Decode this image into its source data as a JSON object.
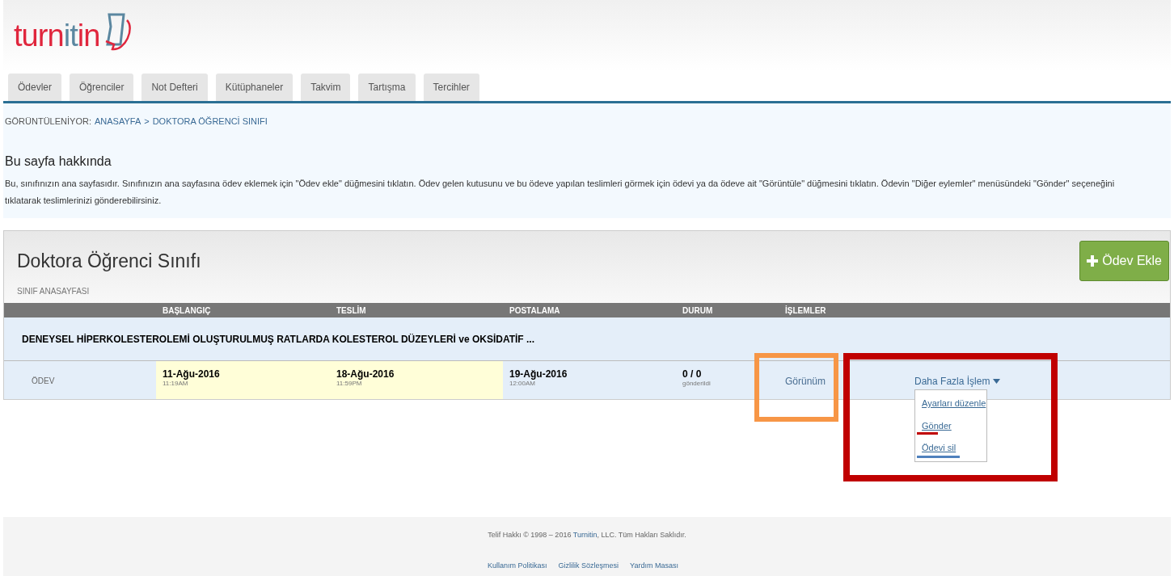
{
  "logo": {
    "parts": [
      {
        "text": "turn",
        "color": "#e0263d"
      },
      {
        "text": "it",
        "color": "#5b87a0"
      },
      {
        "text": "in",
        "color": "#e0263d"
      }
    ]
  },
  "tabs": [
    "Ödevler",
    "Öğrenciler",
    "Not Defteri",
    "Kütüphaneler",
    "Takvim",
    "Tartışma",
    "Tercihler"
  ],
  "breadcrumb": {
    "prefix": "GÖRÜNTÜLENİYOR:",
    "items": [
      "ANASAYFA",
      "DOKTORA ÖĞRENCİ SINIFI"
    ],
    "separator": ">"
  },
  "about": {
    "title": "Bu sayfa hakkında",
    "text": "Bu, sınıfınızın ana sayfasıdır. Sınıfınızın ana sayfasına ödev eklemek için \"Ödev ekle\" düğmesini tıklatın. Ödev gelen kutusunu ve bu ödeve yapılan teslimleri görmek için ödevi ya da ödeve ait \"Görüntüle\" düğmesini tıklatın. Ödevin \"Diğer eylemler\" menüsündeki \"Gönder\" seçeneğini tıklatarak teslimlerinizi gönderebilirsiniz."
  },
  "class_panel": {
    "title": "Doktora Öğrenci Sınıfı",
    "subtitle": "SINIF ANASAYFASI",
    "add_button": "Ödev Ekle",
    "columns": [
      "BAŞLANGIÇ",
      "TESLİM",
      "POSTALAMA",
      "DURUM",
      "İŞLEMLER"
    ],
    "assignments": [
      {
        "title": "DENEYSEL HİPERKOLESTEROLEMİ OLUŞTURULMUŞ RATLARDA KOLESTEROL DÜZEYLERİ ve OKSİDATİF ...",
        "type": "ÖDEV",
        "dates": [
          {
            "date": "11-Ağu-2016",
            "time": "11:19AM",
            "highlighted": true
          },
          {
            "date": "18-Ağu-2016",
            "time": "11:59PM",
            "highlighted": true
          },
          {
            "date": "19-Ağu-2016",
            "time": "12:00AM",
            "highlighted": false
          }
        ],
        "status": {
          "count": "0 / 0",
          "note": "gönderildi"
        },
        "view": "Görünüm",
        "more": {
          "label": "Daha Fazla İşlem",
          "expanded": true,
          "items": [
            "Ayarları düzenle",
            "Gönder",
            "Ödevi sil"
          ]
        }
      }
    ]
  },
  "annotations": [
    {
      "kind": "frame",
      "color": "#f79646"
    },
    {
      "kind": "frame",
      "color": "#c00000"
    },
    {
      "kind": "underline",
      "color": "#c00000"
    },
    {
      "kind": "underline",
      "color": "#4f81bd"
    }
  ],
  "footer": {
    "copyright": {
      "before": "Telif Hakkı © 1998 – 2016 ",
      "link": "Turnitin",
      "after": ", LLC. Tüm Hakları Saklıdır."
    },
    "links": [
      "Kullanım Politikası",
      "Gizlilik Sözleşmesi",
      "Yardım Masası"
    ]
  }
}
